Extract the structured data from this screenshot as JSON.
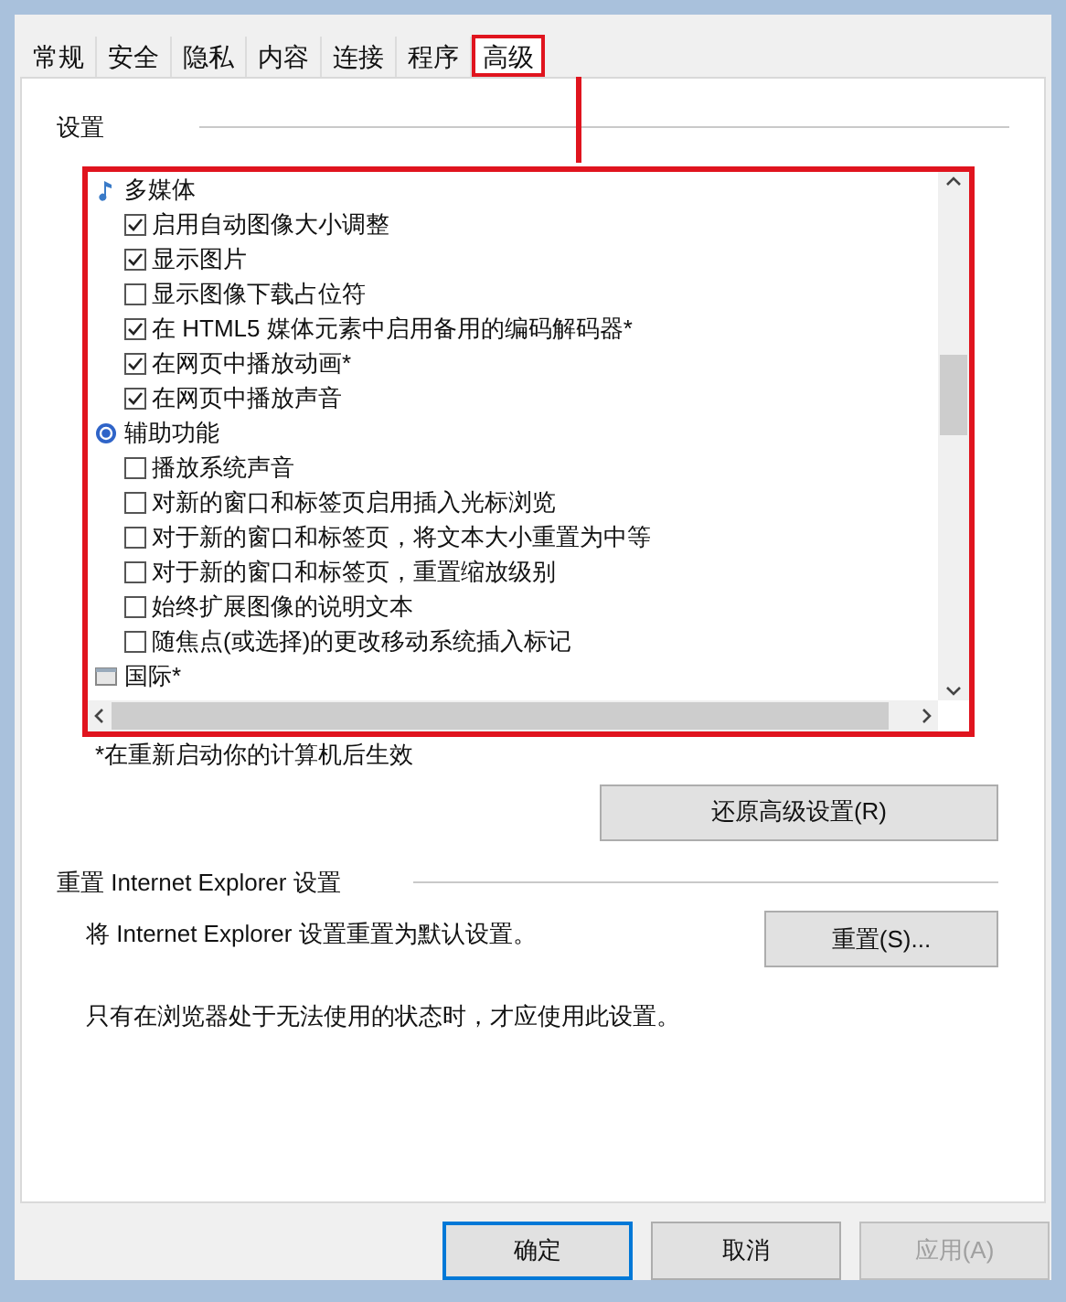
{
  "tabs": [
    {
      "label": "常规",
      "selected": false
    },
    {
      "label": "安全",
      "selected": false
    },
    {
      "label": "隐私",
      "selected": false
    },
    {
      "label": "内容",
      "selected": false
    },
    {
      "label": "连接",
      "selected": false
    },
    {
      "label": "程序",
      "selected": false
    },
    {
      "label": "高级",
      "selected": true
    }
  ],
  "settings": {
    "title": "设置",
    "tree": [
      {
        "kind": "category",
        "label": "多媒体",
        "children": [
          {
            "kind": "option",
            "label": "启用自动图像大小调整",
            "checked": true
          },
          {
            "kind": "option",
            "label": "显示图片",
            "checked": true
          },
          {
            "kind": "option",
            "label": "显示图像下载占位符",
            "checked": false
          },
          {
            "kind": "option",
            "label": "在 HTML5 媒体元素中启用备用的编码解码器*",
            "checked": true
          },
          {
            "kind": "option",
            "label": "在网页中播放动画*",
            "checked": true
          },
          {
            "kind": "option",
            "label": "在网页中播放声音",
            "checked": true
          }
        ]
      },
      {
        "kind": "category",
        "label": "辅助功能",
        "children": [
          {
            "kind": "option",
            "label": "播放系统声音",
            "checked": false
          },
          {
            "kind": "option",
            "label": "对新的窗口和标签页启用插入光标浏览",
            "checked": false
          },
          {
            "kind": "option",
            "label": "对于新的窗口和标签页，将文本大小重置为中等",
            "checked": false
          },
          {
            "kind": "option",
            "label": "对于新的窗口和标签页，重置缩放级别",
            "checked": false
          },
          {
            "kind": "option",
            "label": "始终扩展图像的说明文本",
            "checked": false
          },
          {
            "kind": "option",
            "label": "随焦点(或选择)的更改移动系统插入标记",
            "checked": false
          }
        ]
      },
      {
        "kind": "category",
        "label": "国际*"
      }
    ],
    "footnote": "*在重新启动你的计算机后生效",
    "restore_button": "还原高级设置(R)"
  },
  "reset": {
    "title": "重置 Internet Explorer 设置",
    "description": "将 Internet Explorer 设置重置为默认设置。",
    "button": "重置(S)...",
    "note": "只有在浏览器处于无法使用的状态时，才应使用此设置。"
  },
  "buttons": [
    {
      "label": "确定",
      "default": true,
      "disabled": false
    },
    {
      "label": "取消",
      "default": false,
      "disabled": false
    },
    {
      "label": "应用(A)",
      "default": false,
      "disabled": true
    }
  ]
}
